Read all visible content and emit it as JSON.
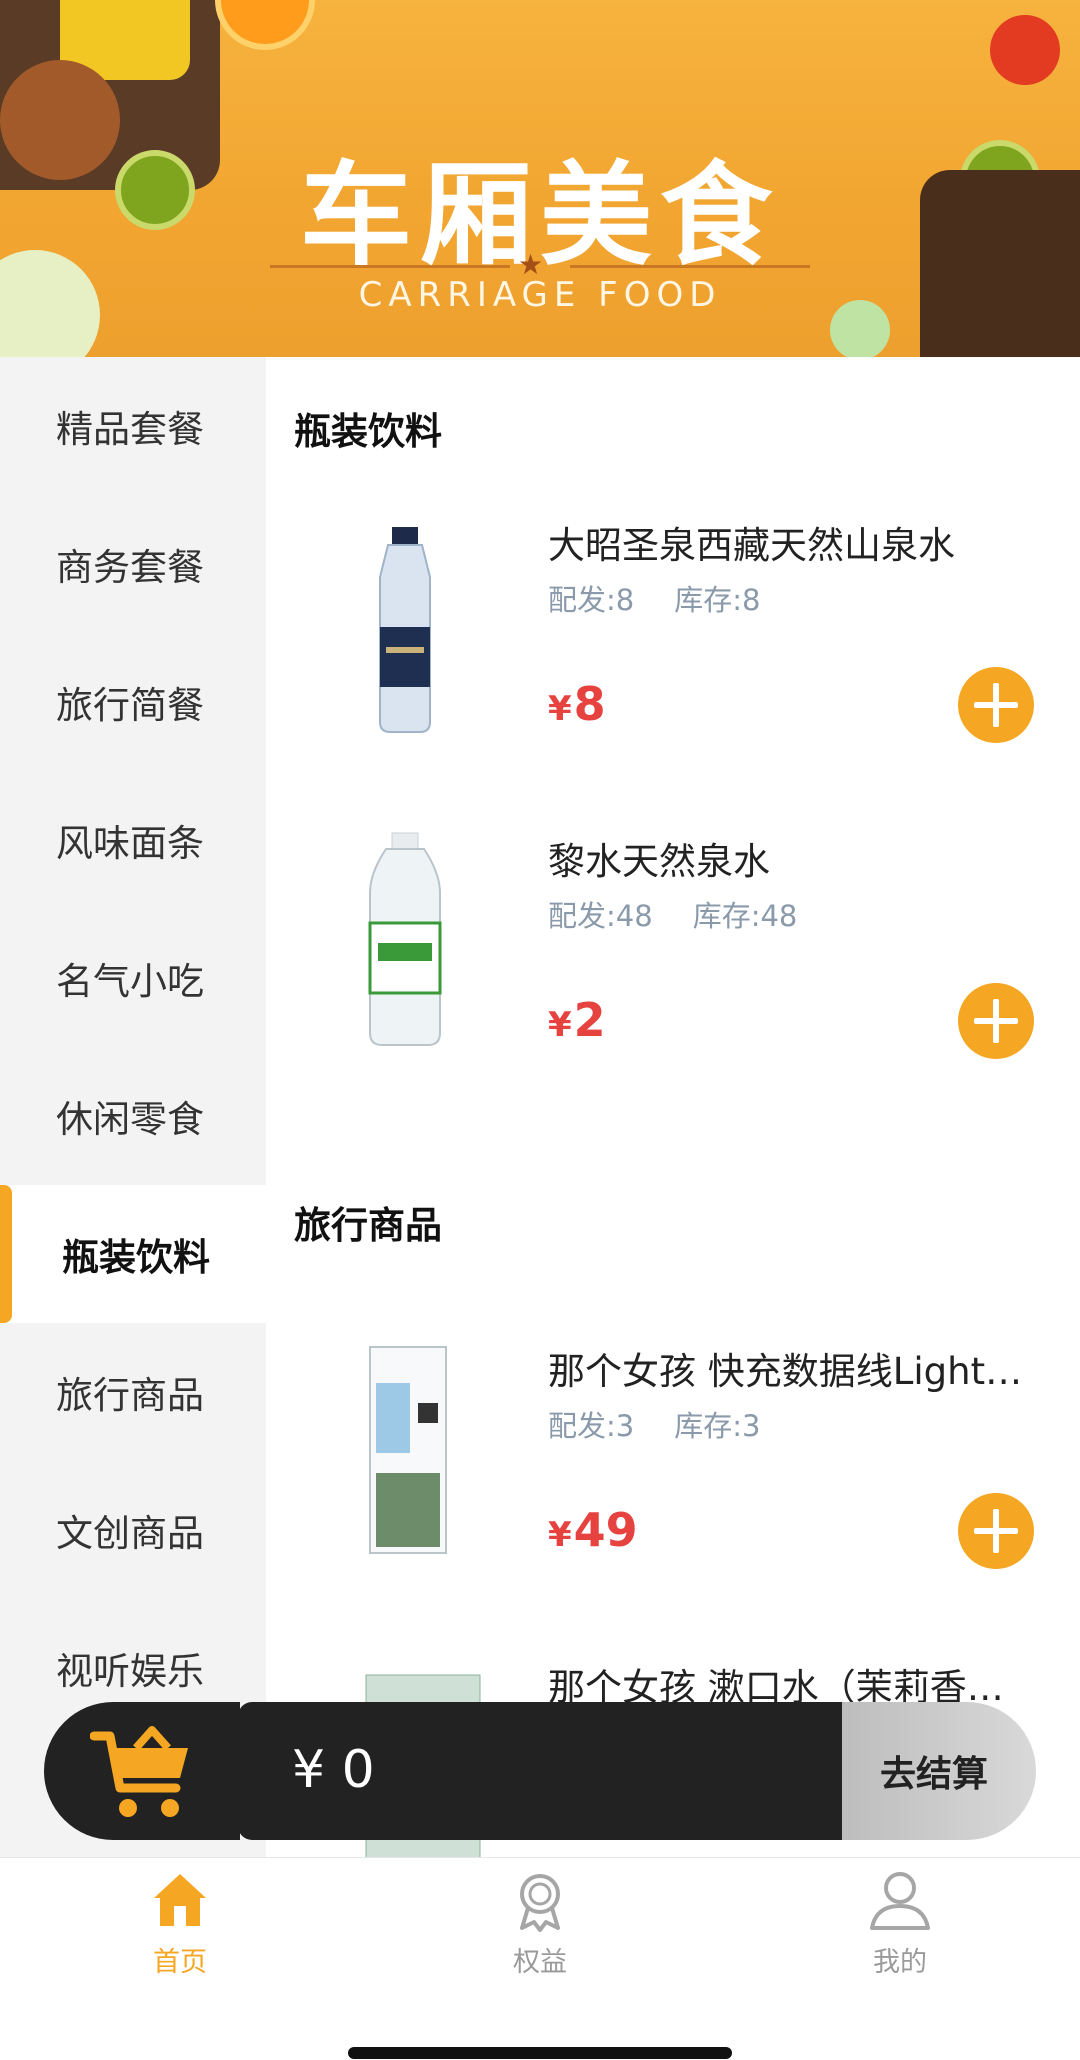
{
  "banner": {
    "title": "车厢美食",
    "subtitle": "CARRIAGE FOOD"
  },
  "sidebar": {
    "items": [
      {
        "label": "精品套餐"
      },
      {
        "label": "商务套餐"
      },
      {
        "label": "旅行简餐"
      },
      {
        "label": "风味面条"
      },
      {
        "label": "名气小吃"
      },
      {
        "label": "休闲零食"
      },
      {
        "label": "瓶装饮料",
        "active": true
      },
      {
        "label": "旅行商品"
      },
      {
        "label": "文创商品"
      },
      {
        "label": "视听娱乐"
      }
    ]
  },
  "sections": [
    {
      "title": "瓶装饮料",
      "products": [
        {
          "name": "大昭圣泉西藏天然山泉水",
          "dist": "配发:8",
          "stock": "库存:8",
          "currency": "¥",
          "price": "8"
        },
        {
          "name": "黎水天然泉水",
          "dist": "配发:48",
          "stock": "库存:48",
          "currency": "¥",
          "price": "2"
        }
      ]
    },
    {
      "title": "旅行商品",
      "products": [
        {
          "name": "那个女孩 快充数据线Light…",
          "dist": "配发:3",
          "stock": "库存:3",
          "currency": "¥",
          "price": "49"
        },
        {
          "name": "那个女孩 漱口水（茉莉香…",
          "dist": "",
          "stock": "",
          "currency": "¥",
          "price": ""
        }
      ]
    }
  ],
  "cart": {
    "amount": "¥ 0",
    "checkout_label": "去结算"
  },
  "tabbar": {
    "items": [
      {
        "label": "首页",
        "icon": "home-icon",
        "active": true
      },
      {
        "label": "权益",
        "icon": "badge-icon"
      },
      {
        "label": "我的",
        "icon": "user-icon"
      }
    ]
  },
  "colors": {
    "accent": "#f5a623",
    "price": "#e64340",
    "meta": "#8a9aab",
    "cart_bar": "#222222"
  }
}
